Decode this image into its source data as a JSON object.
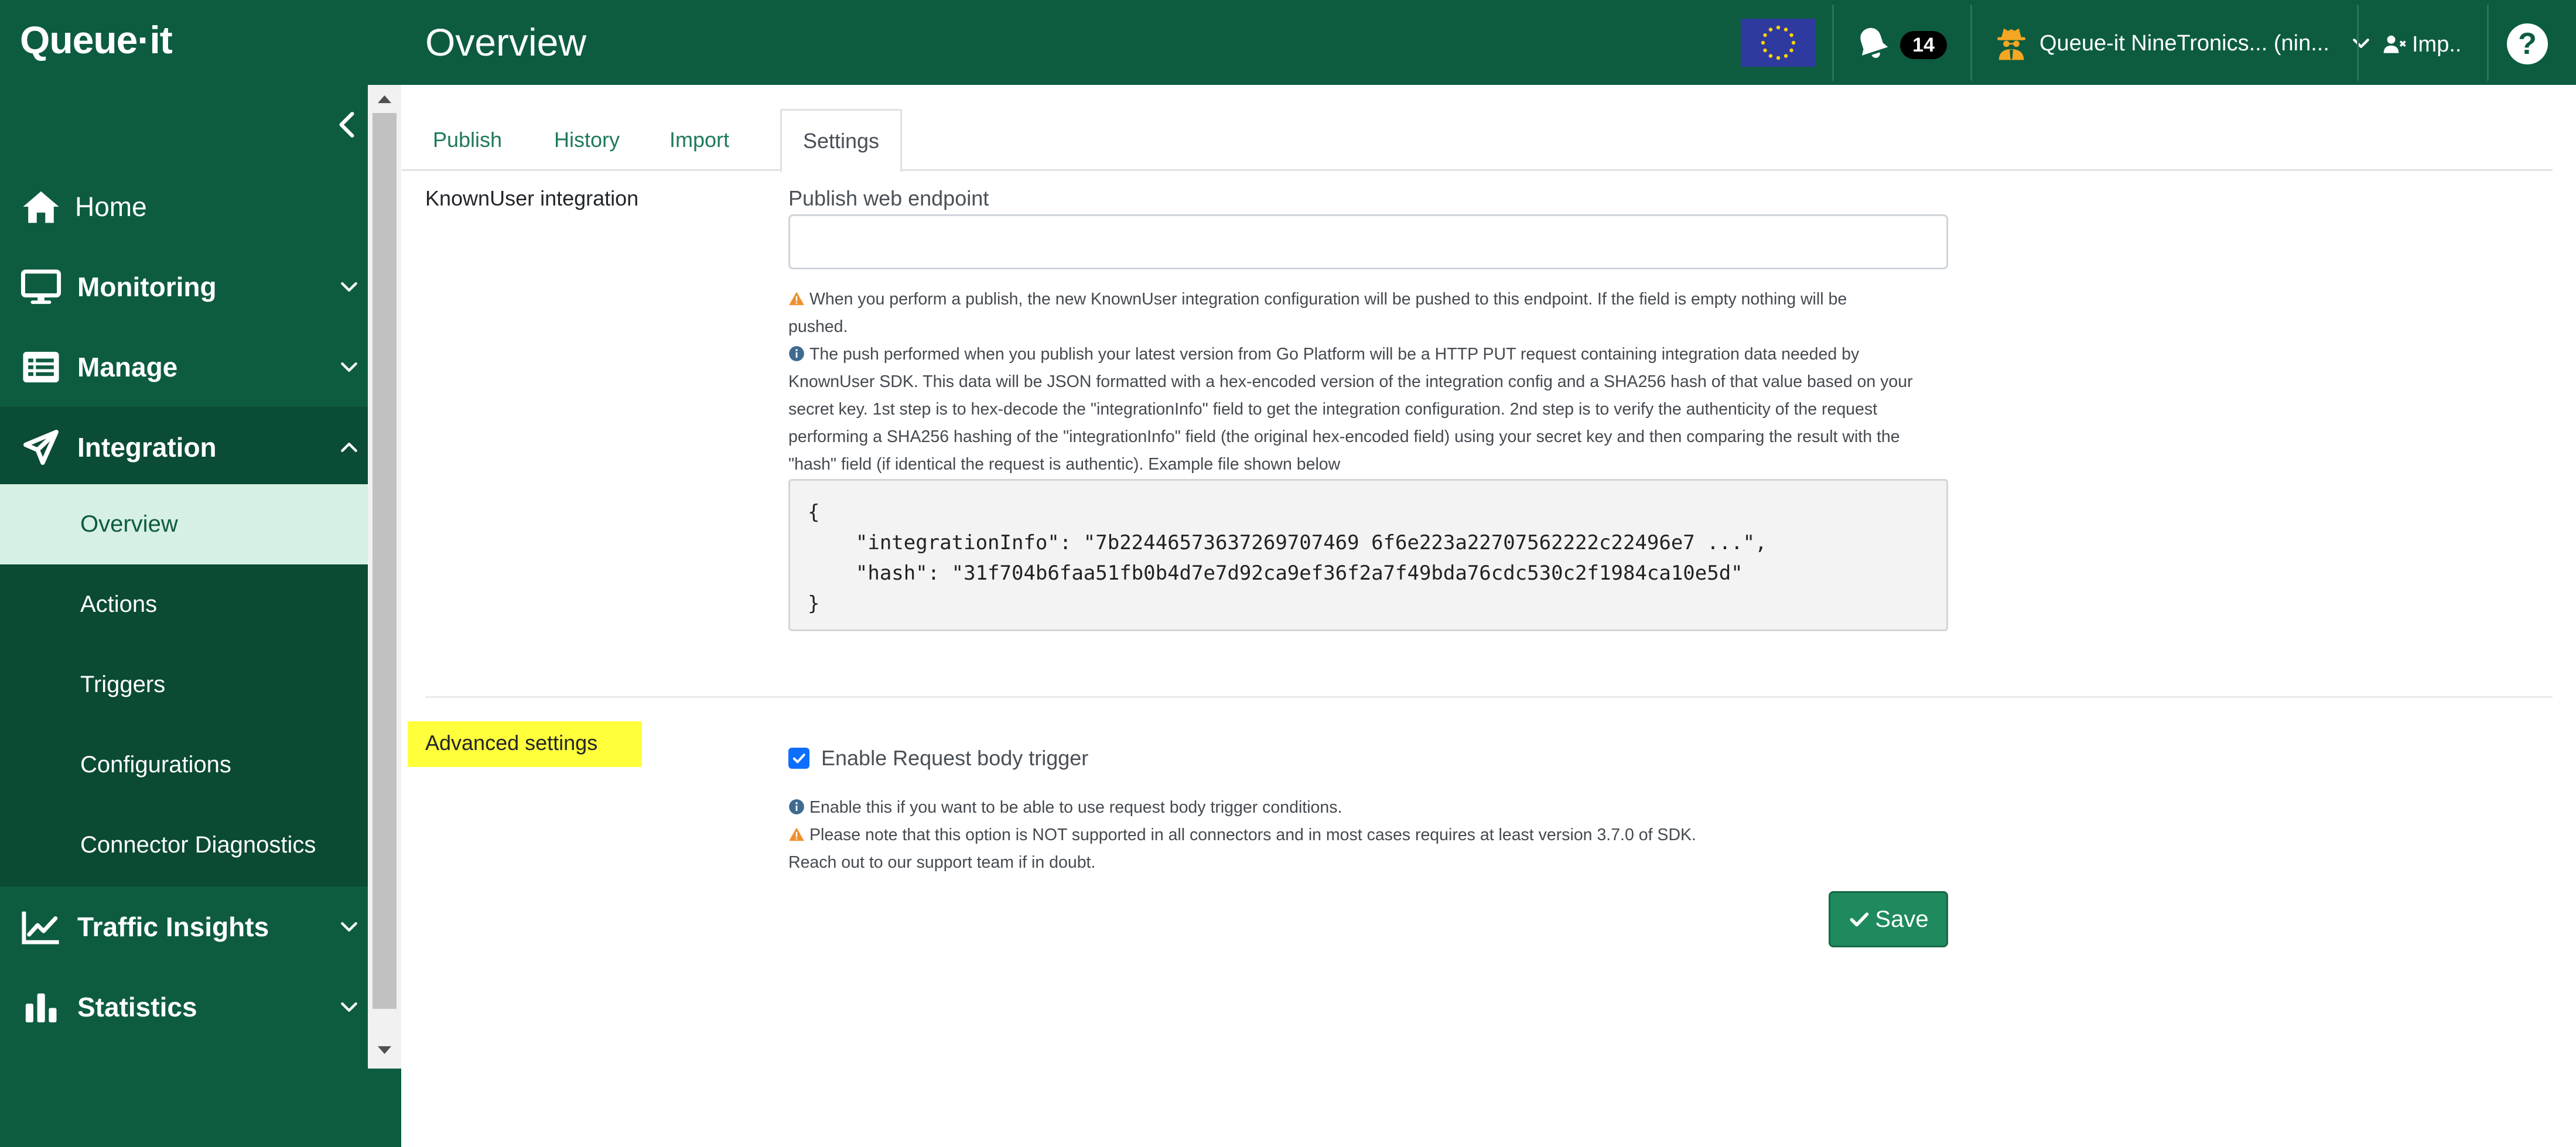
{
  "app": {
    "logo": "Queue·it",
    "page_title": "Overview"
  },
  "header": {
    "notification_count": "14",
    "account_name": "Queue-it NineTronics... (nin...",
    "impersonate_label": "Imp..",
    "help_label": "?",
    "icons": {
      "region": "eu-flag-icon",
      "notifications": "bell-icon",
      "account": "spy-icon",
      "impersonate": "user-x-icon",
      "help": "question-icon"
    }
  },
  "sidebar": {
    "items": [
      {
        "label": "Home",
        "icon": "home-icon"
      },
      {
        "label": "Monitoring",
        "icon": "monitor-icon"
      },
      {
        "label": "Manage",
        "icon": "list-icon"
      },
      {
        "label": "Integration",
        "icon": "integration-icon"
      },
      {
        "label": "Traffic Insights",
        "icon": "line-chart-icon"
      },
      {
        "label": "Statistics",
        "icon": "bar-chart-icon"
      }
    ],
    "subitems": [
      {
        "label": "Overview"
      },
      {
        "label": "Actions"
      },
      {
        "label": "Triggers"
      },
      {
        "label": "Configurations"
      },
      {
        "label": "Connector Diagnostics"
      }
    ],
    "active_subitem": "Overview"
  },
  "tabs": [
    {
      "label": "Publish"
    },
    {
      "label": "History"
    },
    {
      "label": "Import"
    },
    {
      "label": "Settings"
    }
  ],
  "active_tab": "Settings",
  "knownuser": {
    "section_label": "KnownUser integration",
    "field_label": "Publish web endpoint",
    "field_value": "",
    "warning_line1": "When you perform a publish, the new KnownUser integration configuration will be pushed to this endpoint. If the field is empty nothing will be",
    "warning_line2": "pushed.",
    "info_line1": "The push performed when you publish your latest version from Go Platform will be a HTTP PUT request containing integration data needed by",
    "info_line2": "KnownUser SDK. This data will be JSON formatted with a hex-encoded version of the integration config and a SHA256 hash of that value based on your",
    "info_line3": "secret key. 1st step is to hex-decode the \"integrationInfo\" field to get the integration configuration. 2nd step is to verify the authenticity of the request",
    "info_line4": "performing a SHA256 hashing of the \"integrationInfo\" field (the original hex-encoded field) using your secret key and then comparing the result with the",
    "info_line5": "\"hash\" field (if identical the request is authentic). Example file shown below",
    "code_lines": [
      "{",
      "    \"integrationInfo\": \"7b22446573637269707469 6f6e223a22707562222c22496e7 ...\",",
      "    \"hash\": \"31f704b6faa51fb0b4d7e7d92ca9ef36f2a7f49bda76cdc530c2f1984ca10e5d\"",
      "}"
    ]
  },
  "advanced": {
    "section_label": "Advanced settings",
    "checkbox_label": "Enable Request body trigger",
    "checkbox_checked": true,
    "info_text": "Enable this if you want to be able to use request body trigger conditions.",
    "warning_text": "Please note that this option is NOT supported in all connectors and in most cases requires at least version 3.7.0 of SDK.",
    "support_text": "Reach out to our support team if in doubt."
  },
  "actions": {
    "save_label": "Save",
    "save_icon": "check-icon"
  },
  "colors": {
    "brand": "#0d5c40",
    "active_submenu_bg": "#d6f0e3",
    "highlight": "#ffff3b",
    "save_button": "#1e8a5d",
    "checkbox": "#0d6efd",
    "warning": "#f0912e",
    "info": "#3f6b8f"
  }
}
